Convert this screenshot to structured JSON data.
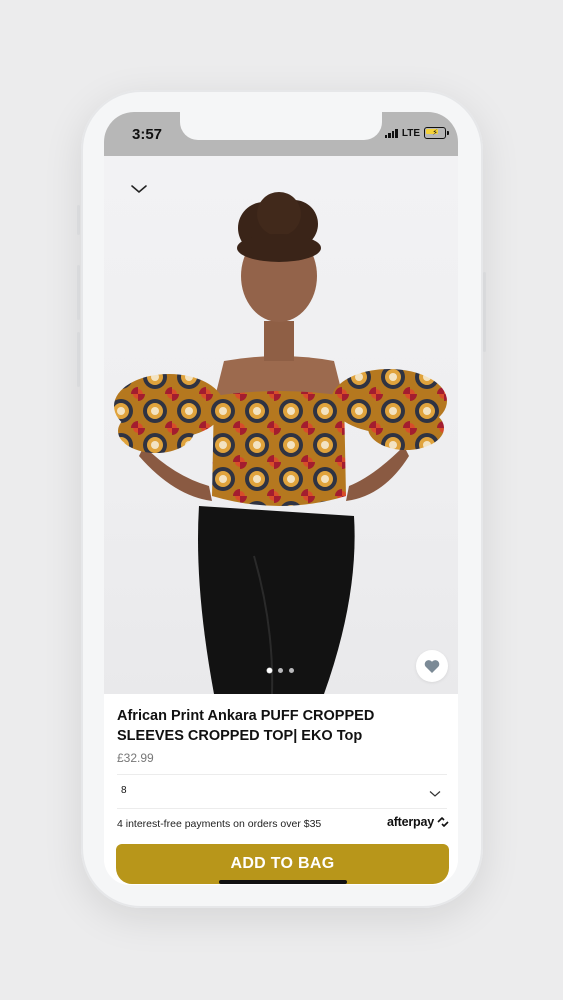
{
  "status_bar": {
    "time": "3:57",
    "network": "LTE"
  },
  "product": {
    "image_alt": "Model wearing African print Ankara puff sleeve cropped top with black leggings",
    "image_count": 3,
    "active_image_index": 0,
    "title": "African Print Ankara PUFF CROPPED SLEEVES CROPPED TOP| EKO Top",
    "price": "£32.99",
    "size_selected": "8"
  },
  "payment": {
    "installments_text": "4 interest-free payments on orders over $35",
    "provider": "afterpay"
  },
  "actions": {
    "add_to_bag": "ADD TO BAG"
  },
  "colors": {
    "accent": "#b8961a",
    "status_bar_bg": "#b7b7b7"
  }
}
